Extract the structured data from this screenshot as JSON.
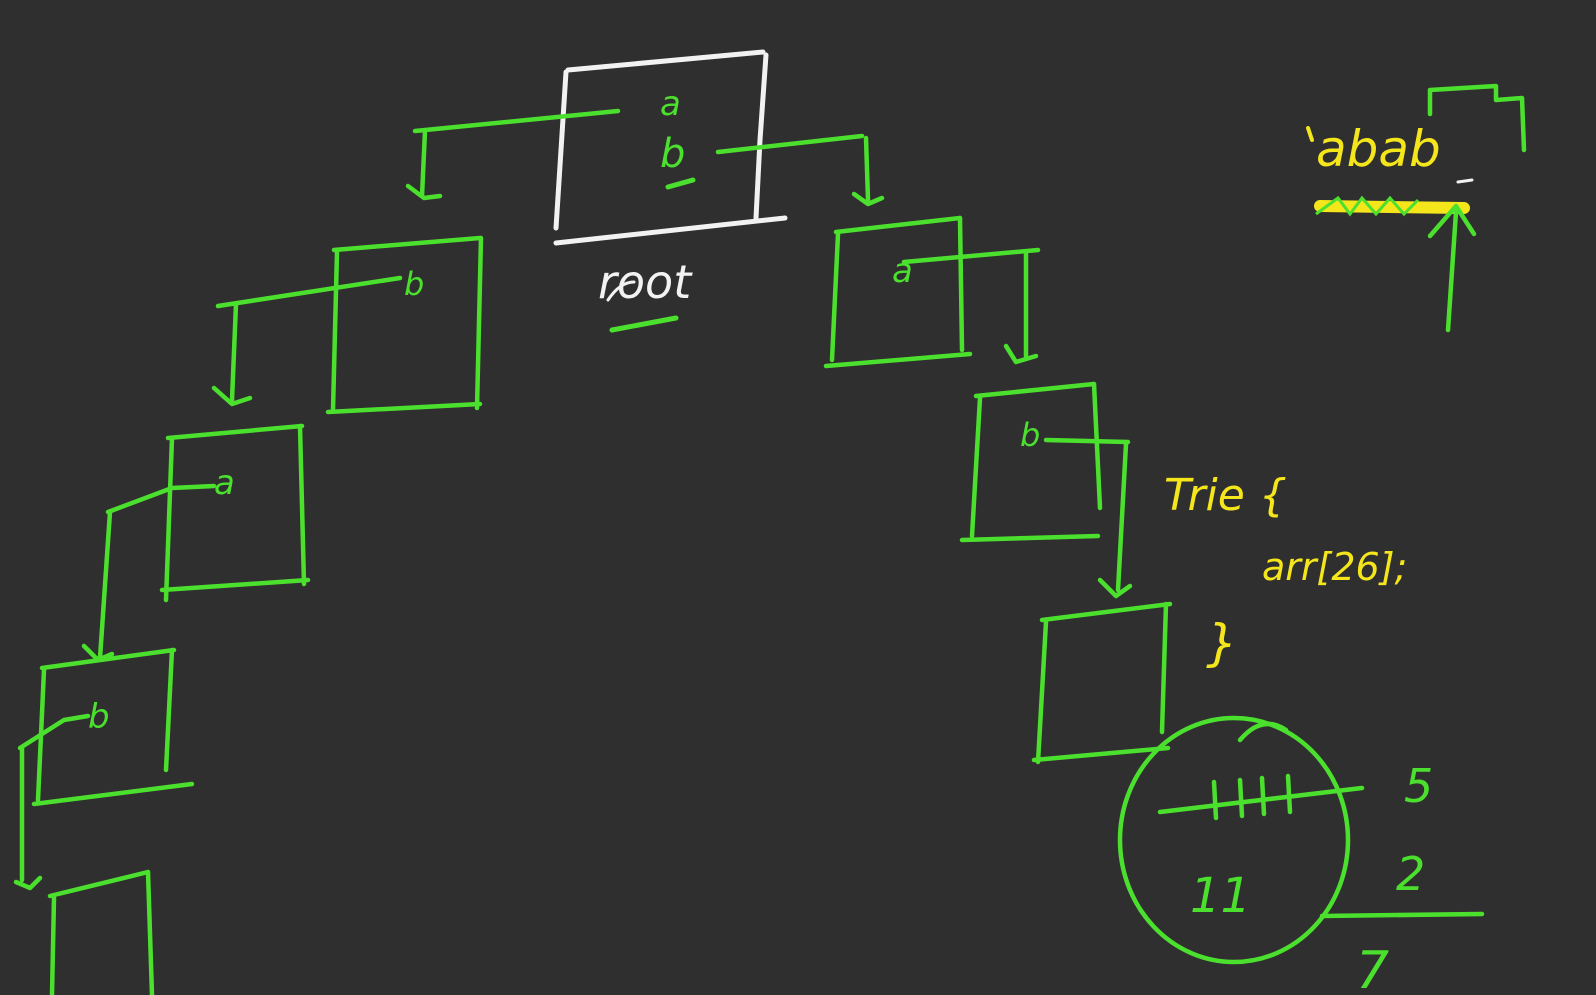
{
  "colors": {
    "background": "#2f2f2f",
    "trie_green": "#4ce02e",
    "root_white": "#f2f2f2",
    "note_yellow": "#f5e61c"
  },
  "root": {
    "chars": [
      "a",
      "b"
    ],
    "label": "root"
  },
  "left_branch": [
    {
      "char": "b"
    },
    {
      "char": "a"
    },
    {
      "char": "b"
    },
    {
      "char": ""
    }
  ],
  "right_branch": [
    {
      "char": "a"
    },
    {
      "char": "b"
    },
    {
      "char": ""
    }
  ],
  "word": {
    "text": "abab"
  },
  "code": {
    "line1": "Trie {",
    "line2": "arr[26];",
    "line3": "}"
  },
  "tally": {
    "inside_count": "11",
    "side_top": "5",
    "side_mid": "2",
    "side_bottom": "7"
  }
}
